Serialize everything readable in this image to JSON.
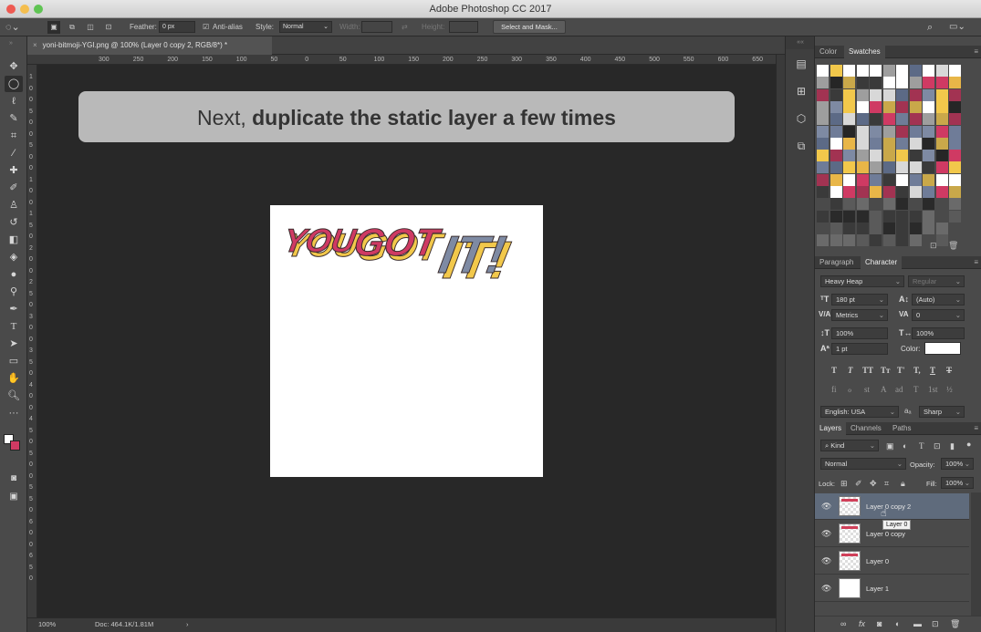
{
  "window": {
    "title": "Adobe Photoshop CC 2017"
  },
  "options_bar": {
    "feather_label": "Feather:",
    "feather_value": "0 px",
    "anti_alias_label": "Anti-alias",
    "style_label": "Style:",
    "style_value": "Normal",
    "width_label": "Width:",
    "height_label": "Height:",
    "select_mask_label": "Select and Mask..."
  },
  "document": {
    "tab_label": "yoni-bitmoji-YGI.png @ 100% (Layer 0 copy 2, RGB/8*) *"
  },
  "rulers": {
    "h": [
      "300",
      "250",
      "200",
      "150",
      "100",
      "50",
      "0",
      "50",
      "100",
      "150",
      "200",
      "250",
      "300",
      "350",
      "400",
      "450",
      "500",
      "550",
      "600",
      "650",
      "700",
      "750"
    ],
    "v": [
      "1",
      "0",
      "0",
      "5",
      "0",
      "0",
      "5",
      "0",
      "0",
      "1",
      "0",
      "0",
      "1",
      "5",
      "0",
      "2",
      "0",
      "0",
      "2",
      "5",
      "0",
      "3",
      "0",
      "0",
      "3",
      "5",
      "0",
      "4",
      "0",
      "0",
      "4",
      "5",
      "0",
      "5",
      "0",
      "0",
      "5",
      "5",
      "0",
      "6",
      "0",
      "0",
      "6",
      "5",
      "0"
    ]
  },
  "banner": {
    "plain": "Next, ",
    "bold": "duplicate the static layer a few times"
  },
  "artwork": {
    "text": "YOU GOT IT!",
    "colors": {
      "pink": "#cf3a63",
      "yellow": "#f2c84b",
      "slate": "#7e8aa3"
    }
  },
  "status": {
    "zoom": "100%",
    "doc": "Doc: 464.1K/1.81M",
    "arrow": "›"
  },
  "swatches_panel": {
    "tabs": [
      "Color",
      "Swatches"
    ],
    "active": "Swatches",
    "colors": [
      "#ffffff",
      "#cf3a63",
      "#f2c84b",
      "#7e8aa3",
      "#3a3a3a",
      "#9e9e9e"
    ]
  },
  "character_panel": {
    "tabs": [
      "Paragraph",
      "Character"
    ],
    "active": "Character",
    "font_family": "Heavy Heap",
    "font_style": "Regular",
    "size": "180 pt",
    "leading": "(Auto)",
    "kerning": "Metrics",
    "tracking": "0",
    "vscale": "100%",
    "hscale": "100%",
    "baseline": "1 pt",
    "color_label": "Color:",
    "color_value": "#ffffff",
    "styles": [
      "T",
      "T",
      "TT",
      "Tт",
      "T'",
      "T,",
      "T",
      "T"
    ],
    "opentype": [
      "fi",
      "ℴ",
      "st",
      "A",
      "ad",
      "T",
      "1st",
      "½"
    ],
    "language": "English: USA",
    "antialias": "Sharp",
    "aa_label": "aₐ"
  },
  "layers_panel": {
    "tabs": [
      "Layers",
      "Channels",
      "Paths"
    ],
    "active": "Layers",
    "filter": "Kind",
    "blend_mode": "Normal",
    "opacity_label": "Opacity:",
    "opacity": "100%",
    "lock_label": "Lock:",
    "fill_label": "Fill:",
    "fill": "100%",
    "tooltip": "Layer 0",
    "layers": [
      {
        "name": "Layer 0 copy 2",
        "selected": true,
        "thumb": "checker"
      },
      {
        "name": "Layer 0 copy",
        "selected": false,
        "thumb": "checker"
      },
      {
        "name": "Layer 0",
        "selected": false,
        "thumb": "checker"
      },
      {
        "name": "Layer 1",
        "selected": false,
        "thumb": "white"
      }
    ],
    "footer_icons": [
      "link-icon",
      "fx-icon",
      "mask-icon",
      "adjustment-icon",
      "folder-icon",
      "new-layer-icon",
      "trash-icon"
    ]
  },
  "tools": [
    "move-tool",
    "marquee-tool",
    "lasso-tool",
    "quick-select-tool",
    "crop-tool",
    "eyedropper-tool",
    "healing-brush-tool",
    "brush-tool",
    "clone-stamp-tool",
    "history-brush-tool",
    "eraser-tool",
    "gradient-tool",
    "blur-tool",
    "dodge-tool",
    "pen-tool",
    "type-tool",
    "path-select-tool",
    "rectangle-tool",
    "hand-tool",
    "zoom-tool",
    "more-tools",
    "color-swap",
    "quick-mask",
    "screen-mode"
  ]
}
